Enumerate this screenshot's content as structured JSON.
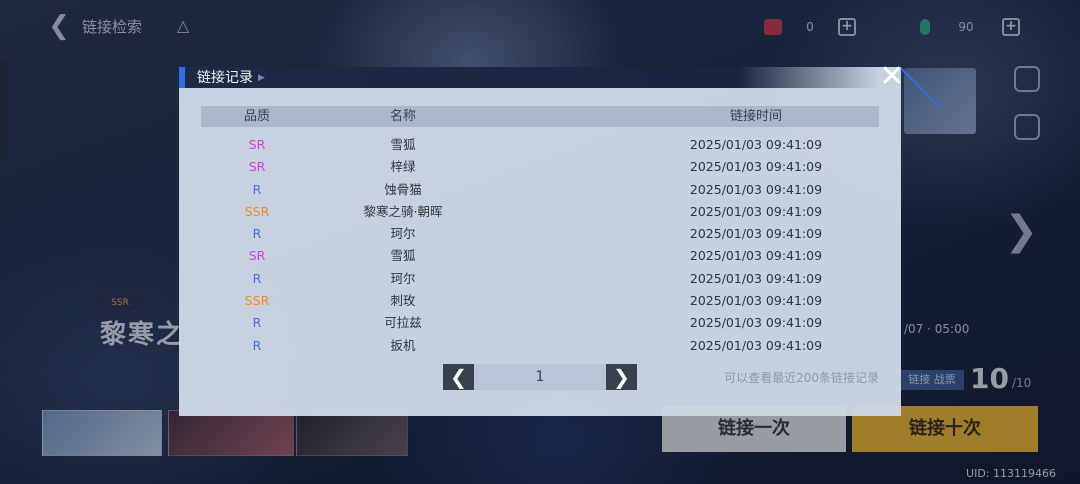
{
  "topbar": {
    "title": "链接检索",
    "currency1_value": "0",
    "currency2_value": "90"
  },
  "background": {
    "character_name": "黎寒之",
    "character_tag": "SSR",
    "date_range": "/07 · 05:00",
    "count_label": "链接 战票",
    "count_value": "10",
    "count_max": "/10",
    "pull_one": "链接一次",
    "pull_ten": "链接十次",
    "uid": "UID:  113119466"
  },
  "modal": {
    "title": "链接记录",
    "headers": {
      "quality": "品质",
      "name": "名称",
      "time": "链接时间"
    },
    "rows": [
      {
        "quality": "SR",
        "name": "雪狐",
        "time": "2025/01/03 09:41:09"
      },
      {
        "quality": "SR",
        "name": "梓绿",
        "time": "2025/01/03 09:41:09"
      },
      {
        "quality": "R",
        "name": "蚀骨猫",
        "time": "2025/01/03 09:41:09"
      },
      {
        "quality": "SSR",
        "name": "黎寒之骑·朝晖",
        "time": "2025/01/03 09:41:09"
      },
      {
        "quality": "R",
        "name": "珂尔",
        "time": "2025/01/03 09:41:09"
      },
      {
        "quality": "SR",
        "name": "雪狐",
        "time": "2025/01/03 09:41:09"
      },
      {
        "quality": "R",
        "name": "珂尔",
        "time": "2025/01/03 09:41:09"
      },
      {
        "quality": "SSR",
        "name": "刺玫",
        "time": "2025/01/03 09:41:09"
      },
      {
        "quality": "R",
        "name": "可拉兹",
        "time": "2025/01/03 09:41:09"
      },
      {
        "quality": "R",
        "name": "扳机",
        "time": "2025/01/03 09:41:09"
      }
    ],
    "pager": {
      "page": "1"
    },
    "note": "可以查看最近200条链接记录"
  },
  "colors": {
    "SR": "#d13fd6",
    "R": "#3f6fe2",
    "SSR": "#f08a1e",
    "accent": "#2e6ee8"
  },
  "icons": {
    "back": "chevron-left-icon",
    "filter": "tree-icon",
    "close": "close-icon",
    "prev": "chevron-left-icon",
    "next": "chevron-right-icon"
  }
}
